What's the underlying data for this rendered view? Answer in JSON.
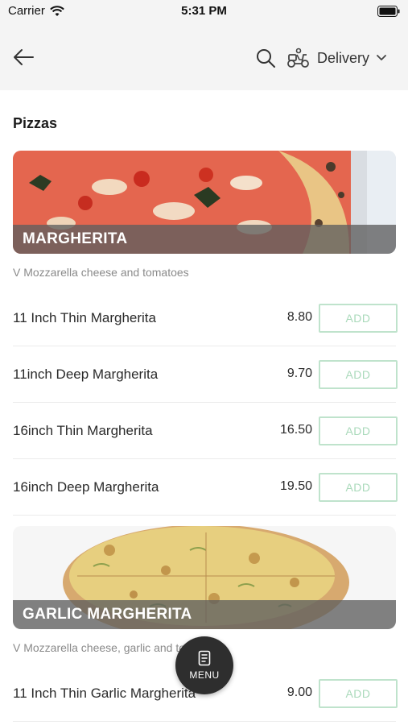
{
  "status_bar": {
    "carrier": "Carrier",
    "time": "5:31 PM",
    "wifi_icon": "wifi-icon",
    "battery_icon": "battery-icon"
  },
  "nav": {
    "back_icon": "arrow-left-icon",
    "search_icon": "search-icon",
    "delivery_icon": "scooter-icon",
    "delivery_label": "Delivery",
    "chevron_icon": "chevron-down-icon"
  },
  "section": {
    "title": "Pizzas"
  },
  "products": [
    {
      "title": "MARGHERITA",
      "description": "V Mozzarella cheese and tomatoes",
      "items": [
        {
          "name": "11 Inch Thin Margherita",
          "price": "8.80",
          "button": "ADD"
        },
        {
          "name": "11inch Deep Margherita",
          "price": "9.70",
          "button": "ADD"
        },
        {
          "name": "16inch Thin Margherita",
          "price": "16.50",
          "button": "ADD"
        },
        {
          "name": "16inch Deep Margherita",
          "price": "19.50",
          "button": "ADD"
        }
      ]
    },
    {
      "title": "GARLIC MARGHERITA",
      "description": "V Mozzarella cheese, garlic and tomatoes",
      "items": [
        {
          "name": "11 Inch Thin Garlic Margherita",
          "price": "9.00",
          "button": "ADD"
        }
      ]
    }
  ],
  "fab": {
    "icon": "menu-book-icon",
    "label": "MENU"
  },
  "colors": {
    "background": "#ffffff",
    "nav_background": "#f4f4f4",
    "add_border": "#bfe3cc",
    "add_text": "#a9d9ba",
    "fab_background": "#2e2e2e"
  }
}
